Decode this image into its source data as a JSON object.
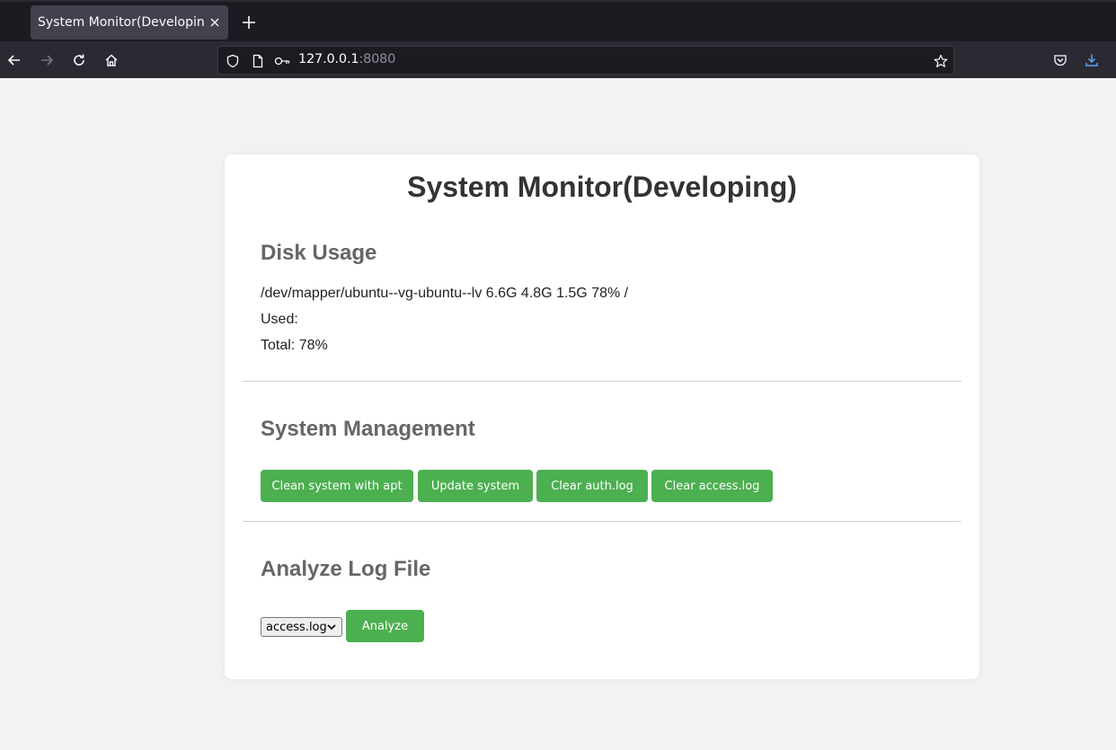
{
  "browser": {
    "tab_title": "System Monitor(Developing)",
    "url_host": "127.0.0.1",
    "url_port": ":8080",
    "icons": [
      "close-icon",
      "plus-icon",
      "back-icon",
      "forward-icon",
      "reload-icon",
      "home-icon",
      "shield-icon",
      "page-icon",
      "key-icon",
      "star-icon",
      "pocket-icon",
      "download-icon"
    ]
  },
  "page": {
    "title": "System Monitor(Developing)",
    "disk": {
      "heading": "Disk Usage",
      "line": "/dev/mapper/ubuntu--vg-ubuntu--lv 6.6G 4.8G 1.5G 78% /",
      "used": "Used:",
      "total": "Total: 78%"
    },
    "management": {
      "heading": "System Management",
      "buttons": [
        "Clean system with apt",
        "Update system",
        "Clear auth.log",
        "Clear access.log"
      ]
    },
    "analyze": {
      "heading": "Analyze Log File",
      "selected_option": "access.log",
      "button": "Analyze"
    }
  },
  "colors": {
    "button_green": "#4caf50",
    "heading_grey": "#666666",
    "download_blue": "#5aa5ff"
  }
}
